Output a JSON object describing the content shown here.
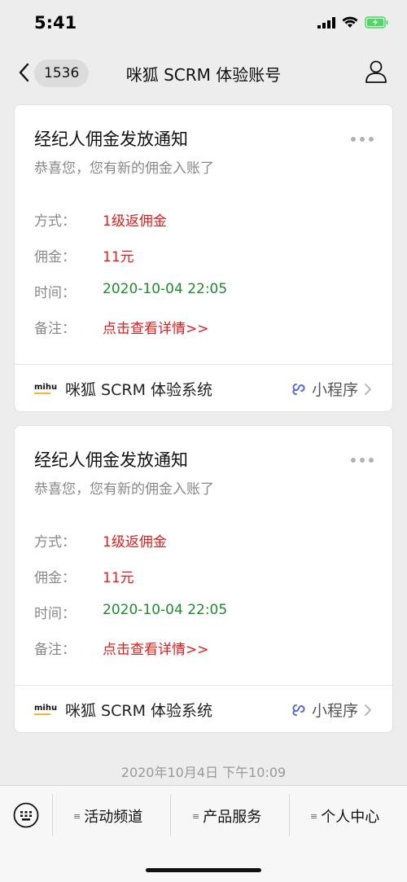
{
  "status_bar": {
    "time": "5:41",
    "battery_color": "#4cd964"
  },
  "nav": {
    "badge": "1536",
    "title": "咪狐 SCRM 体验账号"
  },
  "messages": [
    {
      "title": "经纪人佣金发放通知",
      "subtitle": "恭喜您，您有新的佣金入账了",
      "fields": [
        {
          "label": "方式：",
          "value": "1级返佣金",
          "color": "red"
        },
        {
          "label": "佣金：",
          "value": "11元",
          "color": "red"
        },
        {
          "label": "时间：",
          "value": "2020-10-04 22:05",
          "color": "green"
        },
        {
          "label": "备注：",
          "value": "点击查看详情>>",
          "color": "red"
        }
      ],
      "mini_logo": "mihu",
      "mini_name": "咪狐 SCRM 体验系统",
      "mini_program_label": "小程序"
    },
    {
      "title": "经纪人佣金发放通知",
      "subtitle": "恭喜您，您有新的佣金入账了",
      "fields": [
        {
          "label": "方式：",
          "value": "1级返佣金",
          "color": "red"
        },
        {
          "label": "佣金：",
          "value": "11元",
          "color": "red"
        },
        {
          "label": "时间：",
          "value": "2020-10-04 22:05",
          "color": "green"
        },
        {
          "label": "备注：",
          "value": "点击查看详情>>",
          "color": "red"
        }
      ],
      "mini_logo": "mihu",
      "mini_name": "咪狐 SCRM 体验系统",
      "mini_program_label": "小程序"
    }
  ],
  "timestamp": "2020年10月4日 下午10:09",
  "bottom_menu": {
    "items": [
      {
        "label": "活动频道"
      },
      {
        "label": "产品服务"
      },
      {
        "label": "个人中心"
      }
    ]
  },
  "colors": {
    "red": "#e11d1d",
    "green": "#1f8a2e",
    "background": "#ededed"
  }
}
